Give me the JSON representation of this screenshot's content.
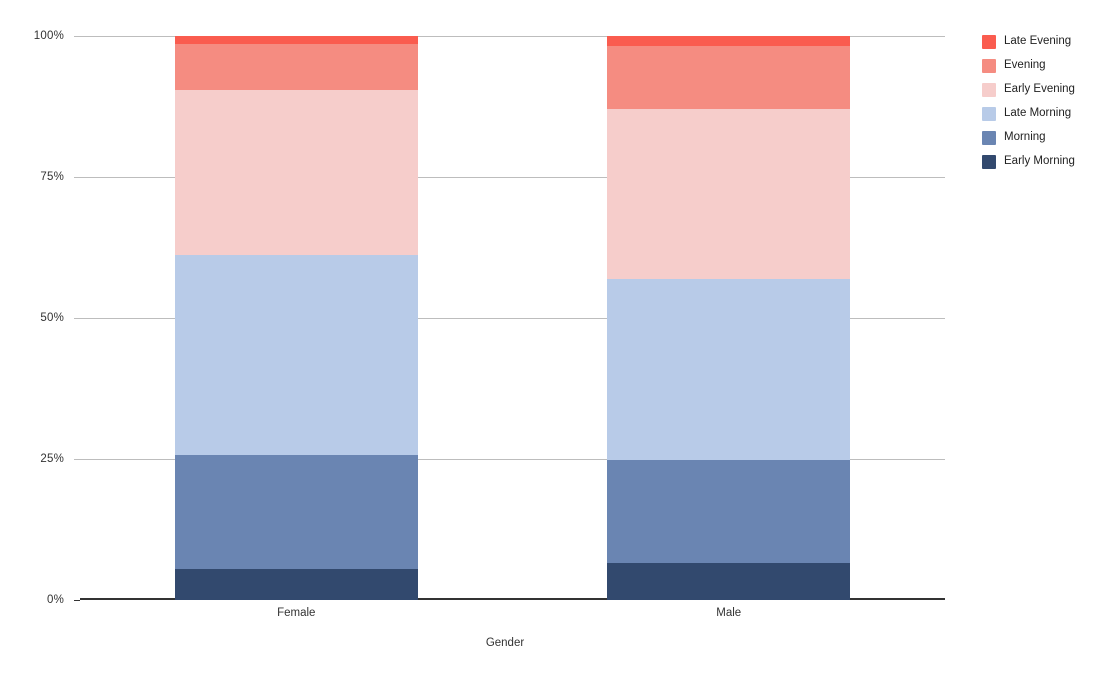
{
  "chart_data": {
    "type": "bar",
    "title": "",
    "subtitle": "",
    "stacked": true,
    "stack_mode": "percent",
    "categories": [
      "Female",
      "Male"
    ],
    "xlabel": "Gender",
    "ylabel": "",
    "ylim": [
      0,
      100
    ],
    "ytick_labels": [
      "0%",
      "25%",
      "50%",
      "75%",
      "100%"
    ],
    "ytick_values": [
      0,
      25,
      50,
      75,
      100
    ],
    "grid": true,
    "legend_position": "right",
    "series": [
      {
        "name": "Early Morning",
        "color": "#32496e",
        "values": [
          5.5,
          6.6
        ]
      },
      {
        "name": "Morning",
        "color": "#6a85b2",
        "values": [
          20.2,
          18.2
        ]
      },
      {
        "name": "Late Morning",
        "color": "#b8cbe8",
        "values": [
          35.5,
          32.1
        ]
      },
      {
        "name": "Early Evening",
        "color": "#f6cdcb",
        "values": [
          29.3,
          30.3
        ]
      },
      {
        "name": "Evening",
        "color": "#f58c81",
        "values": [
          8.0,
          11.2
        ]
      },
      {
        "name": "Late Evening",
        "color": "#fa5c4f",
        "values": [
          1.5,
          1.7
        ]
      }
    ],
    "legend_entries": [
      {
        "label": "Late Evening",
        "color": "#fa5c4f"
      },
      {
        "label": "Evening",
        "color": "#f58c81"
      },
      {
        "label": "Early Evening",
        "color": "#f6cdcb"
      },
      {
        "label": "Late Morning",
        "color": "#b8cbe8"
      },
      {
        "label": "Morning",
        "color": "#6a85b2"
      },
      {
        "label": "Early Morning",
        "color": "#32496e"
      }
    ],
    "axis_line_color": "#333333",
    "gridline_color": "#bdbdbd",
    "background_color": "#ffffff"
  }
}
